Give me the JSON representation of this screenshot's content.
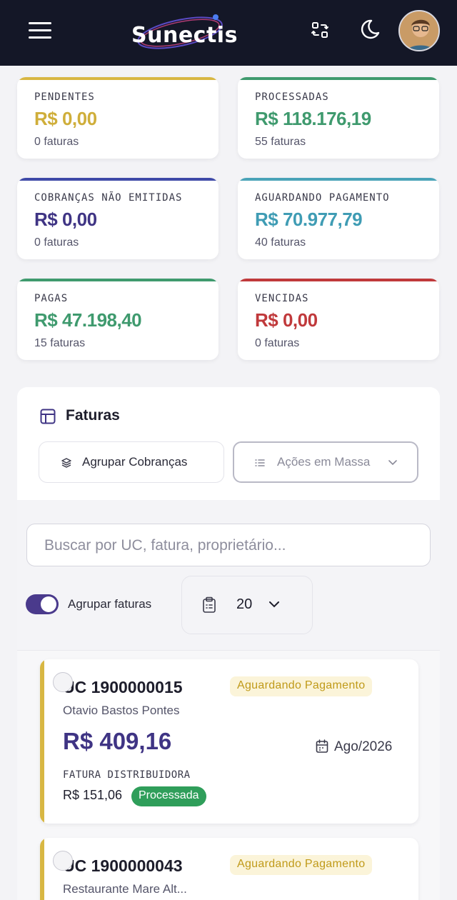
{
  "header": {
    "brand": "Sunectis",
    "icons": {
      "menu": "hamburger-menu-icon",
      "swap": "swap-icon",
      "theme": "moon-icon",
      "avatar": "user-avatar"
    }
  },
  "stats": [
    {
      "label": "PENDENTES",
      "value": "R$ 0,00",
      "count": "0 faturas",
      "color": "#cfae3a"
    },
    {
      "label": "PROCESSADAS",
      "value": "R$ 118.176,19",
      "count": "55 faturas",
      "color": "#3f9a6e"
    },
    {
      "label": "COBRANÇAS NÃO EMITIDAS",
      "value": "R$ 0,00",
      "count": "0 faturas",
      "color": "#3f3484"
    },
    {
      "label": "AGUARDANDO PAGAMENTO",
      "value": "R$ 70.977,79",
      "count": "40 faturas",
      "color": "#3f9cb4"
    },
    {
      "label": "PAGAS",
      "value": "R$ 47.198,40",
      "count": "15 faturas",
      "color": "#3f9a6e"
    },
    {
      "label": "VENCIDAS",
      "value": "R$ 0,00",
      "count": "0 faturas",
      "color": "#c0393b"
    }
  ],
  "faturas": {
    "title": "Faturas",
    "agrupar_cobrancas": "Agrupar Cobranças",
    "acoes_em_massa": "Ações em Massa",
    "search_placeholder": "Buscar por UC, fatura, proprietário...",
    "agrupar_faturas_label": "Agrupar faturas",
    "agrupar_faturas_on": true,
    "per_page": "20"
  },
  "invoices": [
    {
      "uc": "UC 1900000015",
      "status": "Aguardando Pagamento",
      "owner": "Otavio Bastos Pontes",
      "amount": "R$ 409,16",
      "date": "Ago/2026",
      "dist_label": "FATURA DISTRIBUIDORA",
      "dist_value": "R$ 151,06",
      "dist_status": "Processada"
    },
    {
      "uc": "UC 1900000043",
      "status": "Aguardando Pagamento",
      "owner": "Restaurante Mare Alt..."
    }
  ]
}
